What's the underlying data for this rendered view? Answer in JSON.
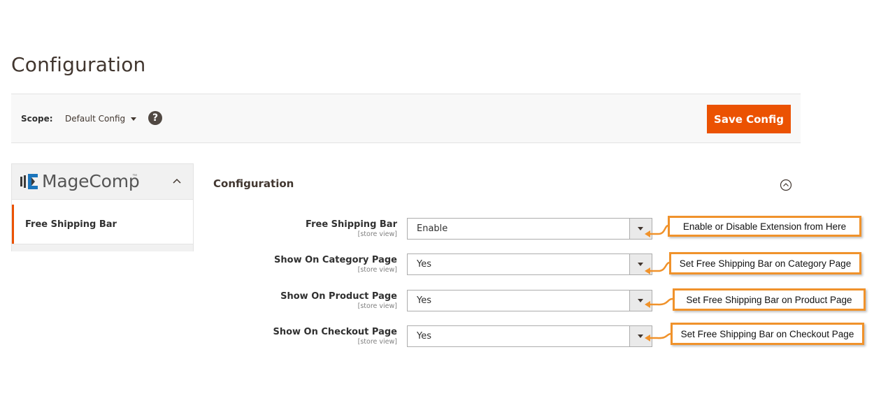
{
  "page": {
    "title": "Configuration"
  },
  "scope_bar": {
    "label": "Scope:",
    "current": "Default Config",
    "help": "?",
    "save_label": "Save Config"
  },
  "sidebar": {
    "brand": "MageComp",
    "brand_tm": "™",
    "items": [
      {
        "label": "Free Shipping Bar",
        "active": true
      }
    ]
  },
  "section": {
    "title": "Configuration",
    "fields": [
      {
        "label": "Free Shipping Bar",
        "scope": "[store view]",
        "value": "Enable"
      },
      {
        "label": "Show On Category Page",
        "scope": "[store view]",
        "value": "Yes"
      },
      {
        "label": "Show On Product Page",
        "scope": "[store view]",
        "value": "Yes"
      },
      {
        "label": "Show On Checkout Page",
        "scope": "[store view]",
        "value": "Yes"
      }
    ]
  },
  "callouts": [
    "Enable or Disable Extension from Here",
    "Set Free Shipping Bar on Category Page",
    "Set Free Shipping Bar on Product Page",
    "Set Free Shipping Bar on Checkout Page"
  ],
  "colors": {
    "accent": "#eb5202",
    "callout_border": "#f0922b",
    "brand_blue": "#1b75bc"
  }
}
